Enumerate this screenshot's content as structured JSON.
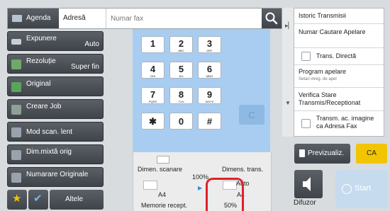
{
  "topbar": {
    "agenda_label": "Agenda",
    "address_label": "Adresă",
    "fax_placeholder": "Numar fax",
    "search_icon": "search-icon"
  },
  "left": {
    "buttons": [
      {
        "label": "Expunere",
        "value": "Auto"
      },
      {
        "label": "Rezoluție",
        "value": "Super fin"
      },
      {
        "label": "Original",
        "value": ""
      },
      {
        "label": "Creare Job",
        "value": ""
      },
      {
        "label": "Mod scan. lent",
        "value": ""
      },
      {
        "label": "Dim.mixtă orig",
        "value": ""
      },
      {
        "label": "Numarare Originale",
        "value": ""
      }
    ],
    "other_label": "Altele"
  },
  "keypad": {
    "keys": [
      {
        "d": "1",
        "s": ""
      },
      {
        "d": "2",
        "s": "ABC"
      },
      {
        "d": "3",
        "s": "DEF"
      },
      {
        "d": "4",
        "s": "GHI"
      },
      {
        "d": "5",
        "s": "JKL"
      },
      {
        "d": "6",
        "s": "MNO"
      },
      {
        "d": "7",
        "s": "PQRS"
      },
      {
        "d": "8",
        "s": "TUV"
      },
      {
        "d": "9",
        "s": "WXYZ"
      },
      {
        "d": "✱",
        "s": ""
      },
      {
        "d": "0",
        "s": ""
      },
      {
        "d": "#",
        "s": ""
      }
    ],
    "clear_label": "C"
  },
  "status": {
    "scan_size_label": "Dimen. scanare",
    "send_size_label": "Dimens. trans.",
    "ratio": "100%",
    "scan_size": "A4",
    "send_auto": "Auto",
    "send_size": "A4",
    "memory_label": "Memorie recept.",
    "memory_value": "50%"
  },
  "right": {
    "items": [
      "Istoric Transmisii",
      "Numar Cautare Apelare",
      "Trans. Directă",
      "Program apelare",
      "Setari inreg. de apel",
      "Verifica Stare Transmis/Receptionat",
      "Transm. ac. imagine ca Adresa Fax"
    ],
    "preview_label": "Previzualiz.",
    "ca_label": "CA",
    "speaker_label": "Difuzor",
    "start_label": "Start"
  },
  "colors": {
    "keypad_bg": "#a9cdf0",
    "ca_yellow": "#f2c500",
    "highlight_red": "#e0202b",
    "dark_button": "#474c52"
  }
}
